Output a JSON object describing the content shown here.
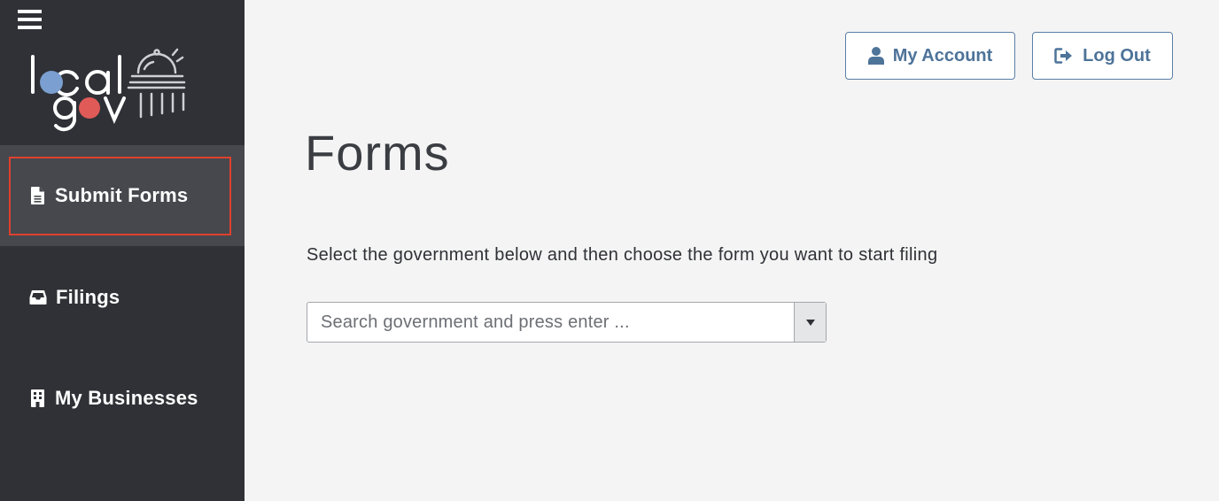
{
  "logo": {
    "text_top": "local",
    "text_bottom": "gov"
  },
  "sidebar": {
    "menu_icon": "hamburger-icon",
    "items": [
      {
        "label": "Submit Forms",
        "icon": "file-icon",
        "active": true
      },
      {
        "label": "Filings",
        "icon": "inbox-icon",
        "active": false
      },
      {
        "label": "My Businesses",
        "icon": "building-icon",
        "active": false
      }
    ]
  },
  "header": {
    "account_label": "My Account",
    "account_icon": "user-icon",
    "logout_label": "Log Out",
    "logout_icon": "sign-out-icon"
  },
  "main": {
    "title": "Forms",
    "instruction": "Select the government below and then choose the form you want to start filing",
    "search": {
      "placeholder": "Search government and press enter ...",
      "value": ""
    }
  },
  "colors": {
    "sidebar_bg": "#2f3136",
    "active_item_bg": "#46484d",
    "active_border": "#e0402e",
    "accent_blue": "#4d7399",
    "logo_blue": "#7a9fd0",
    "logo_red": "#e05a58",
    "page_bg": "#f4f4f4"
  }
}
